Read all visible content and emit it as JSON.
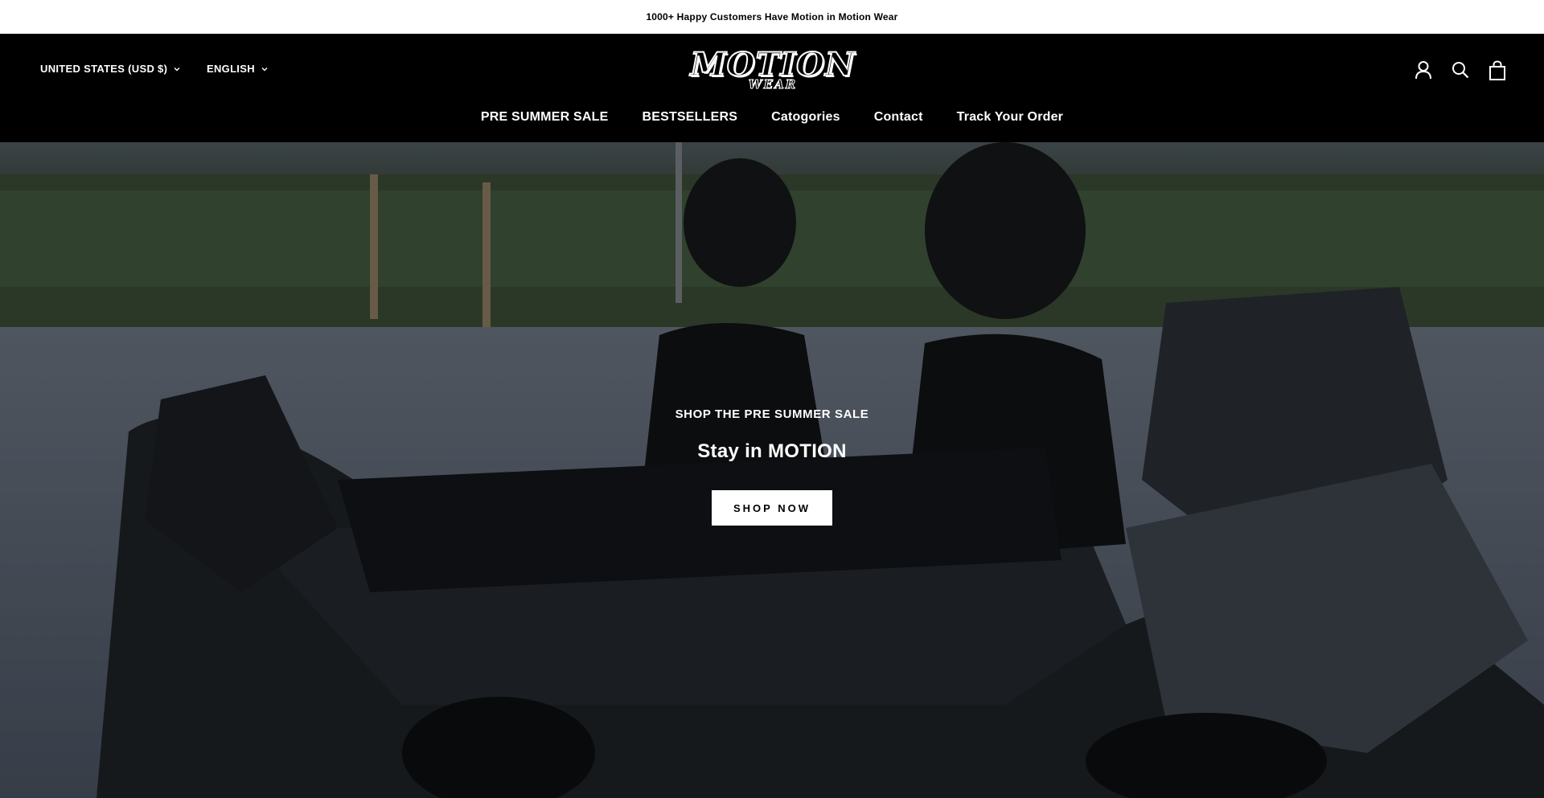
{
  "announcement": {
    "text": "1000+ Happy Customers Have Motion in Motion Wear"
  },
  "header": {
    "country_selector": {
      "label": "UNITED STATES (USD $)"
    },
    "language_selector": {
      "label": "ENGLISH"
    },
    "logo": {
      "main": "MOTION",
      "sub": "WEAR"
    },
    "icons": [
      "account-icon",
      "search-icon",
      "cart-icon"
    ]
  },
  "nav": {
    "items": [
      {
        "label": "PRE SUMMER SALE"
      },
      {
        "label": "BESTSELLERS"
      },
      {
        "label": "Catogories"
      },
      {
        "label": "Contact"
      },
      {
        "label": "Track Your Order"
      }
    ]
  },
  "hero": {
    "kicker": "SHOP THE PRE SUMMER SALE",
    "title": "Stay in MOTION",
    "cta": "SHOP NOW"
  },
  "colors": {
    "header_bg": "#000000",
    "announcement_bg": "#ffffff",
    "cta_bg": "#ffffff"
  }
}
